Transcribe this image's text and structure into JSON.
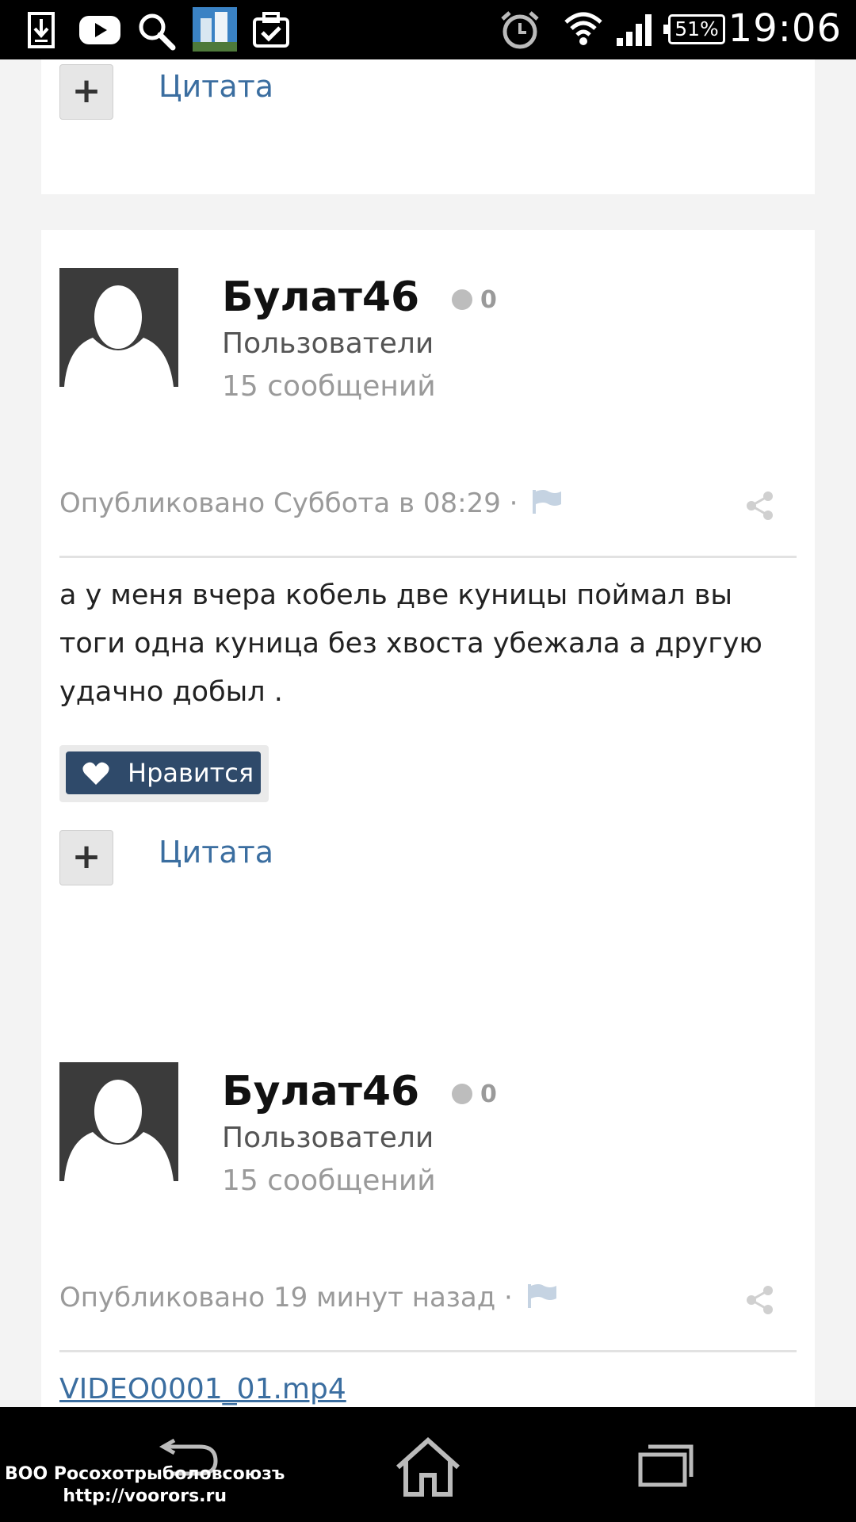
{
  "status_bar": {
    "time": "19:06",
    "battery": "51%",
    "icons": [
      "download-icon",
      "youtube-icon",
      "search-icon",
      "app-thumbnail-icon",
      "clipboard-check-icon",
      "alarm-icon",
      "wifi-icon",
      "signal-icon",
      "battery-icon"
    ]
  },
  "top_card": {
    "quote_label": "Цитата"
  },
  "posts": [
    {
      "username": "Булат46",
      "reputation": "0",
      "group": "Пользователи",
      "post_count": "15 сообщений",
      "published": "Опубликовано Суббота в 08:29 ·",
      "content": "а у меня вчера кобель две куницы поймал вы тоги одна куница без хвоста убежала а другую удачно добыл .",
      "like_label": "Нравится",
      "quote_label": "Цитата"
    },
    {
      "username": "Булат46",
      "reputation": "0",
      "group": "Пользователи",
      "post_count": "15 сообщений",
      "published": "Опубликовано 19 минут назад ·",
      "attachment": "VIDEO0001_01.mp4"
    }
  ],
  "watermark": {
    "line1": "ВОО Росохотрыболовсоюзъ",
    "line2": "http://voorors.ru"
  },
  "colors": {
    "link": "#3b6ea0",
    "like_button": "#2f4a6a",
    "page_bg": "#f3f3f3"
  }
}
